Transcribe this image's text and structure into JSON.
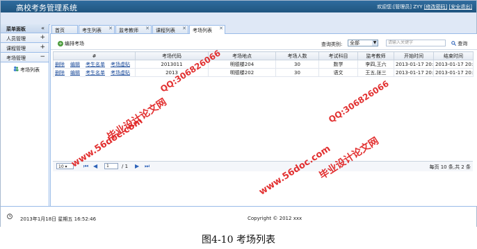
{
  "header": {
    "app_title": "高校考务管理系统",
    "welcome": "欢迎您:[管理员]",
    "username": "ZYY",
    "change_password": "[修改密码]",
    "logout": "[安全退出]"
  },
  "sidebar": {
    "title": "菜单面板",
    "collapse_symbol": "«",
    "groups": [
      {
        "label": "人员管理",
        "symbol": "+"
      },
      {
        "label": "课程管理",
        "symbol": "+"
      },
      {
        "label": "考场管理",
        "symbol": "−"
      }
    ],
    "active_item": "考场列表"
  },
  "tabs": [
    {
      "label": "首页"
    },
    {
      "label": "考生列表"
    },
    {
      "label": "监考教师"
    },
    {
      "label": "课程列表"
    },
    {
      "label": "考场列表"
    }
  ],
  "toolbar": {
    "add_label": "编排考场",
    "query_label": "查询类别:",
    "query_select_value": "全部",
    "search_placeholder": "请输入关键字",
    "search_button": "查询"
  },
  "grid": {
    "headers": [
      "#",
      "考场代码",
      "考场地点",
      "考场人数",
      "考试科目",
      "监考教师",
      "开始时间",
      "结束时间"
    ],
    "op_labels": [
      "删除",
      "编辑",
      "考生名单",
      "考场虚贴"
    ],
    "rows": [
      {
        "code": "2013011",
        "location": "明德楼204",
        "count": "30",
        "subject": "数学",
        "teachers": "李四,王六",
        "start": "2013-01-17 20:",
        "end": "2013-01-17 20:"
      },
      {
        "code": "2013",
        "location": "明德楼202",
        "count": "30",
        "subject": "语文",
        "teachers": "王五,张三",
        "start": "2013-01-17 20:",
        "end": "2013-01-17 20:"
      }
    ]
  },
  "pager": {
    "page_size": "10",
    "current_page": "1",
    "total_pages": "/ 1",
    "info": "每页 10 条,共 2 条"
  },
  "footer": {
    "datetime": "2013年1月18日 星期五 16:52:46",
    "copyright": "Copyright © 2012 xxx"
  },
  "caption": "图4-10 考场列表",
  "watermarks": {
    "site": "www.56doc.com",
    "qq": "QQ:306826066",
    "name": "毕业设计论文网"
  },
  "colors": {
    "header_bg": "#2a6393",
    "link": "#1a4a9a",
    "watermark": "#e02020"
  }
}
